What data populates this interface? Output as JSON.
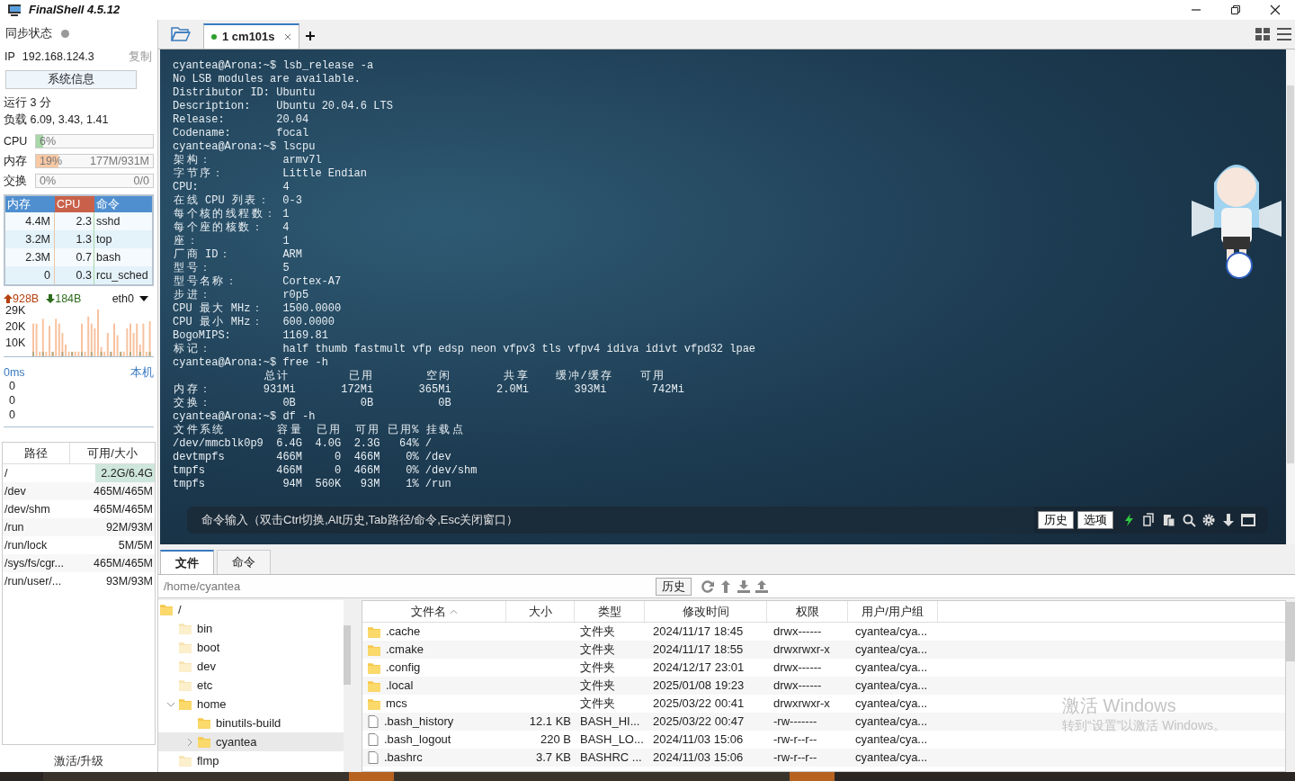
{
  "window": {
    "title": "FinalShell 4.5.12"
  },
  "sidebar": {
    "sync_label": "同步状态",
    "synced": false,
    "ip_label": "IP",
    "ip": "192.168.124.3",
    "copy": "复制",
    "sysinfo_button": "系统信息",
    "uptime": "运行 3 分",
    "load": "负载 6.09, 3.43, 1.41",
    "meters": [
      {
        "label": "CPU",
        "reading": "6%",
        "level": 0.06,
        "color": "#a8d8a8"
      },
      {
        "label": "内存",
        "reading": "19%",
        "detail": "177M/931M",
        "level": 0.19,
        "color": "#f8c9a4"
      },
      {
        "label": "交换",
        "reading": "0%",
        "detail": "0/0"
      }
    ],
    "processes": {
      "columns": [
        {
          "label": "内存",
          "selected": false
        },
        {
          "label": "CPU",
          "selected": true
        },
        {
          "label": "命令",
          "selected": false
        }
      ],
      "rows": [
        {
          "mem": "4.4M",
          "cpu": "2.3",
          "command": "sshd"
        },
        {
          "mem": "3.2M",
          "cpu": "1.3",
          "command": "top"
        },
        {
          "mem": "2.3M",
          "cpu": "0.7",
          "command": "bash"
        },
        {
          "mem": "0",
          "cpu": "0.3",
          "command": "rcu_sched"
        }
      ]
    },
    "network": {
      "upload": "928B",
      "download": "184B",
      "interface": "eth0",
      "y_labels": [
        "29K",
        "20K",
        "10K"
      ]
    },
    "ping": {
      "latency": "0ms",
      "host": "本机",
      "y_labels": [
        "0",
        "0",
        "0"
      ]
    },
    "disks": {
      "columns": [
        "路径",
        "可用/大小"
      ],
      "rows": [
        {
          "path": "/",
          "free": "2.2G/6.4G",
          "selected": true
        },
        {
          "path": "/dev",
          "free": "465M/465M",
          "selected": false
        },
        {
          "path": "/dev/shm",
          "free": "465M/465M",
          "selected": false
        },
        {
          "path": "/run",
          "free": "92M/93M",
          "selected": false
        },
        {
          "path": "/run/lock",
          "free": "5M/5M",
          "selected": false
        },
        {
          "path": "/sys/fs/cgr...",
          "free": "465M/465M",
          "selected": false
        },
        {
          "path": "/run/user/...",
          "free": "93M/93M",
          "selected": false
        }
      ]
    },
    "activate": "激活/升级"
  },
  "tabs": [
    {
      "label": "1 cm101s",
      "selected": true,
      "connected": true
    }
  ],
  "terminal": {
    "lines": [
      "cyantea@Arona:~$ lsb_release -a",
      "No LSB modules are available.",
      "Distributor ID: Ubuntu",
      "Description:    Ubuntu 20.04.6 LTS",
      "Release:        20.04",
      "Codename:       focal",
      "cyantea@Arona:~$ lscpu",
      "架构：           armv7l",
      "字节序：         Little Endian",
      "CPU:             4",
      "在线 CPU 列表：  0-3",
      "每个核的线程数： 1",
      "每个座的核数：   4",
      "座：             1",
      "厂商 ID：        ARM",
      "型号：           5",
      "型号名称：       Cortex-A7",
      "步进：           r0p5",
      "CPU 最大 MHz：   1500.0000",
      "CPU 最小 MHz：   600.0000",
      "BogoMIPS:        1169.81",
      "标记：           half thumb fastmult vfp edsp neon vfpv3 tls vfpv4 idiva idivt vfpd32 lpae",
      "cyantea@Arona:~$ free -h",
      "              总计         已用        空闲        共享    缓冲/缓存    可用",
      "内存：        931Mi       172Mi       365Mi       2.0Mi       393Mi       742Mi",
      "交换：           0B          0B          0B",
      "cyantea@Arona:~$ df -h",
      "文件系统        容量  已用  可用 已用% 挂载点",
      "/dev/mmcblk0p9  6.4G  4.0G  2.3G   64% /",
      "devtmpfs        466M     0  466M    0% /dev",
      "tmpfs           466M     0  466M    0% /dev/shm",
      "tmpfs            94M  560K   93M    1% /run"
    ],
    "command_bar": {
      "placeholder": "命令输入（双击Ctrl切换,Alt历史,Tab路径/命令,Esc关闭窗口）",
      "buttons": [
        "历史",
        "选项"
      ]
    }
  },
  "files": {
    "tabs": [
      {
        "label": "文件",
        "selected": true
      },
      {
        "label": "命令",
        "selected": false
      }
    ],
    "path": "/home/cyantea",
    "history_button": "历史",
    "tree": [
      {
        "name": "/",
        "expanded": true,
        "selected": false,
        "children": [
          {
            "name": "bin",
            "selected": false
          },
          {
            "name": "boot",
            "selected": false
          },
          {
            "name": "dev",
            "selected": false
          },
          {
            "name": "etc",
            "selected": false
          },
          {
            "name": "home",
            "expanded": true,
            "selected": false,
            "children": [
              {
                "name": "binutils-build",
                "selected": false
              },
              {
                "name": "cyantea",
                "expanded": false,
                "selected": true
              }
            ]
          },
          {
            "name": "flmp",
            "selected": false
          }
        ]
      }
    ],
    "columns": [
      {
        "label": "文件名",
        "sorted": true
      },
      {
        "label": "大小",
        "sorted": false
      },
      {
        "label": "类型",
        "sorted": false
      },
      {
        "label": "修改时间",
        "sorted": false
      },
      {
        "label": "权限",
        "sorted": false
      },
      {
        "label": "用户/用户组",
        "sorted": false
      }
    ],
    "rows": [
      {
        "kind": "folder",
        "name": ".cache",
        "type": "文件夹",
        "modified": "2024/11/17 18:45",
        "permissions": "drwx------",
        "owner": "cyantea/cya..."
      },
      {
        "kind": "folder",
        "name": ".cmake",
        "type": "文件夹",
        "modified": "2024/11/17 18:55",
        "permissions": "drwxrwxr-x",
        "owner": "cyantea/cya..."
      },
      {
        "kind": "folder",
        "name": ".config",
        "type": "文件夹",
        "modified": "2024/12/17 23:01",
        "permissions": "drwx------",
        "owner": "cyantea/cya..."
      },
      {
        "kind": "folder",
        "name": ".local",
        "type": "文件夹",
        "modified": "2025/01/08 19:23",
        "permissions": "drwx------",
        "owner": "cyantea/cya..."
      },
      {
        "kind": "folder",
        "name": "mcs",
        "type": "文件夹",
        "modified": "2025/03/22 00:41",
        "permissions": "drwxrwxr-x",
        "owner": "cyantea/cya..."
      },
      {
        "kind": "file",
        "name": ".bash_history",
        "size": "12.1 KB",
        "type": "BASH_HI...",
        "modified": "2025/03/22 00:47",
        "permissions": "-rw-------",
        "owner": "cyantea/cya..."
      },
      {
        "kind": "file",
        "name": ".bash_logout",
        "size": "220 B",
        "type": "BASH_LO...",
        "modified": "2024/11/03 15:06",
        "permissions": "-rw-r--r--",
        "owner": "cyantea/cya..."
      },
      {
        "kind": "file",
        "name": ".bashrc",
        "size": "3.7 KB",
        "type": "BASHRC ...",
        "modified": "2024/11/03 15:06",
        "permissions": "-rw-r--r--",
        "owner": "cyantea/cya..."
      }
    ]
  },
  "watermark": {
    "title": "激活 Windows",
    "subtitle": "转到“设置”以激活 Windows。"
  }
}
